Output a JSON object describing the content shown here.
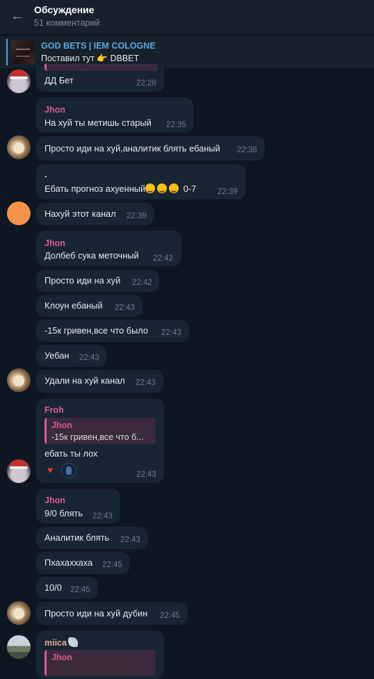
{
  "header": {
    "title": "Обсуждение",
    "subtitle": "51 комментарий"
  },
  "pinned": {
    "channel": "GOD BETS | IEM COLOGNE",
    "message": "Поставил тут 👉 DBBET"
  },
  "messages": [
    {
      "text": "ДД Бет",
      "time": "22:28"
    },
    {
      "name": "Jhon",
      "text": "На хуй ты метишь старый",
      "time": "22:35"
    },
    {
      "text": "Просто иди на хуй,аналитик блять ебаный",
      "time": "22:38"
    },
    {
      "name": ".",
      "text": "Ебать прогноз ахуенный",
      "suffix": "0-7",
      "time": "22:39"
    },
    {
      "text": "Нахуй этот канал",
      "time": "22:39"
    },
    {
      "name": "Jhon",
      "text": "Долбеб сука меточный",
      "time": "22:42"
    },
    {
      "text": "Просто иди на хуй",
      "time": "22:42"
    },
    {
      "text": "Клоун ебаный",
      "time": "22:43"
    },
    {
      "text": "-15к гривен,все что было",
      "time": "22:43"
    },
    {
      "text": "Уебан",
      "time": "22:43"
    },
    {
      "text": "Удали на хуй канал",
      "time": "22:43"
    },
    {
      "name": "Froh",
      "reply_name": "Jhon",
      "reply_text": "-15к гривен,все что б...",
      "text": "ебать ты лох",
      "time": "22:43"
    },
    {
      "name": "Jhon",
      "text": "9/0 блять",
      "time": "22:43"
    },
    {
      "text": "Аналитик блять",
      "time": "22:43"
    },
    {
      "text": "Пхахаххаха",
      "time": "22:45"
    },
    {
      "text": "10/0",
      "time": "22:45"
    },
    {
      "text": "Просто иди на хуй дубин",
      "time": "22:45"
    },
    {
      "name": "miica",
      "reply_name": "Jhon"
    }
  ]
}
